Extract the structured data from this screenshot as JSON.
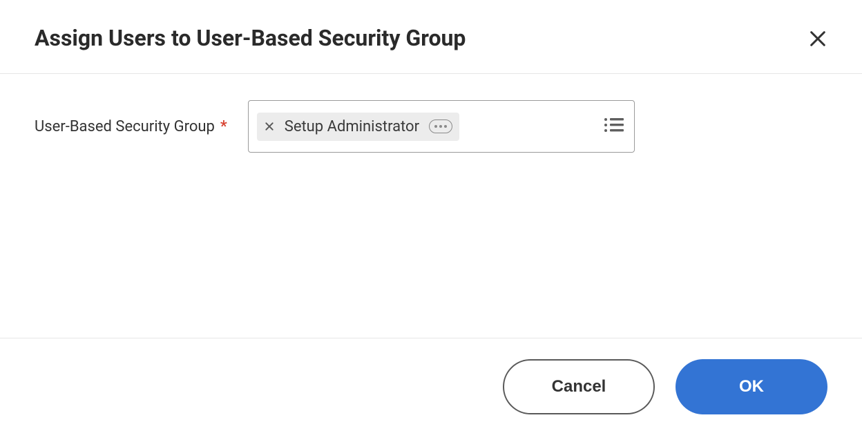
{
  "dialog": {
    "title": "Assign Users to User-Based Security Group"
  },
  "field": {
    "label": "User-Based Security Group",
    "required_marker": "*",
    "selected_value": "Setup Administrator"
  },
  "footer": {
    "cancel_label": "Cancel",
    "ok_label": "OK"
  }
}
